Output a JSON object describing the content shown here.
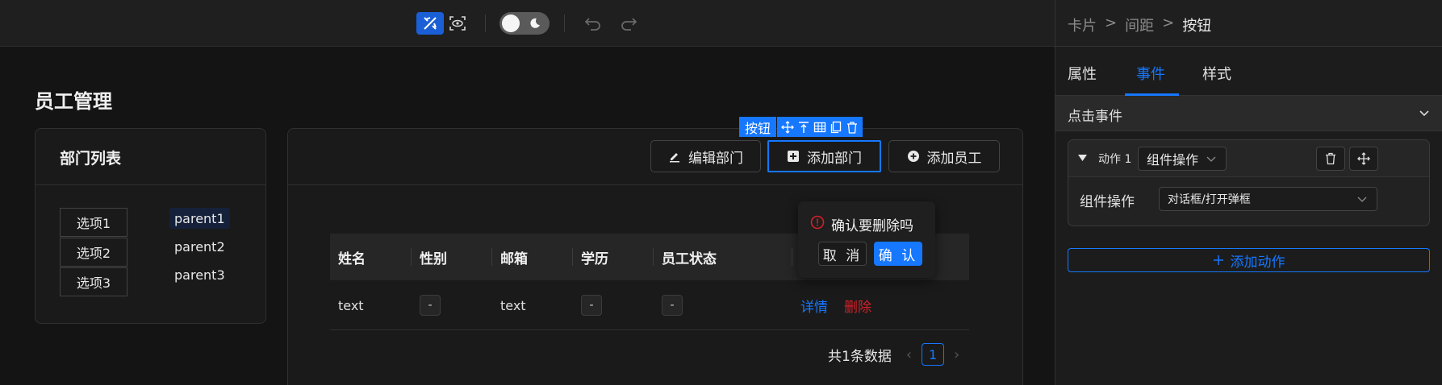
{
  "toolbar": {
    "icons": [
      "design-mode-icon",
      "preview-icon",
      "theme-toggle",
      "undo-icon",
      "redo-icon"
    ]
  },
  "page": {
    "title": "员工管理"
  },
  "dept_card": {
    "title": "部门列表",
    "options": [
      "选项1",
      "选项2",
      "选项3"
    ],
    "tree": [
      "parent1",
      "parent2",
      "parent3"
    ]
  },
  "main_card": {
    "selected_tag": "按钮",
    "buttons": {
      "edit": "编辑部门",
      "add_dept": "添加部门",
      "add_emp": "添加员工"
    },
    "table": {
      "columns": [
        "姓名",
        "性别",
        "邮箱",
        "学历",
        "员工状态"
      ],
      "rows": [
        {
          "name": "text",
          "gender": "-",
          "email": "text",
          "edu": "-",
          "status": "-",
          "detail": "详情",
          "delete": "删除"
        }
      ]
    },
    "popconfirm": {
      "text": "确认要删除吗",
      "cancel": "取 消",
      "ok": "确 认"
    },
    "pagination": {
      "total_text": "共1条数据",
      "current": "1"
    }
  },
  "panel": {
    "breadcrumb": [
      "卡片",
      ">",
      "间距",
      ">",
      "按钮"
    ],
    "tabs": [
      "属性",
      "事件",
      "样式"
    ],
    "active_tab": "事件",
    "section_title": "点击事件",
    "action": {
      "label": "动作 1",
      "type": "组件操作",
      "field_label": "组件操作",
      "field_value": "对话框/打开弹框"
    },
    "add_action": "添加动作"
  },
  "colors": {
    "accent": "#1677ff",
    "danger": "#d32029",
    "background": "#141414"
  }
}
